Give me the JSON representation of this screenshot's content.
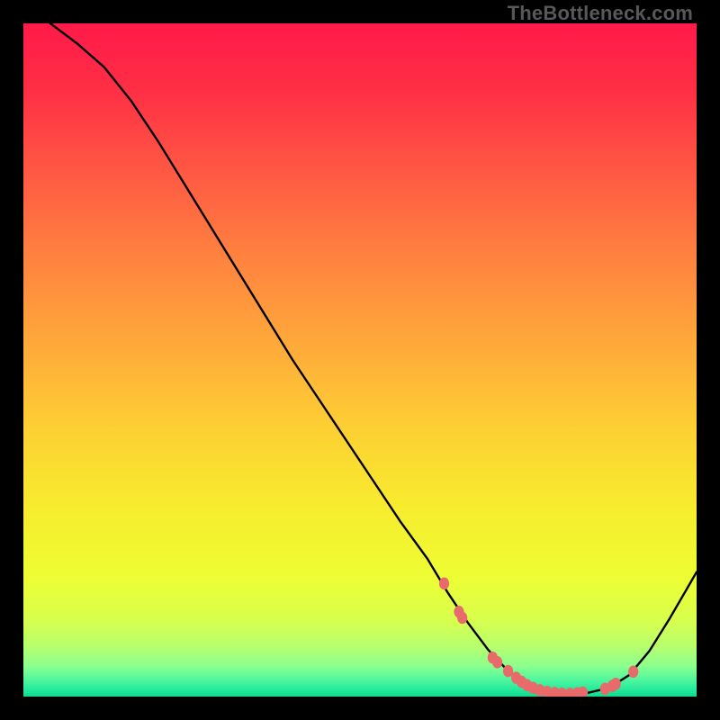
{
  "watermark": {
    "text": "TheBottleneck.com"
  },
  "chart_data": {
    "type": "line",
    "title": "",
    "xlabel": "",
    "ylabel": "",
    "xlim": [
      0,
      100
    ],
    "ylim": [
      0,
      100
    ],
    "grid": false,
    "legend": false,
    "series": [
      {
        "name": "curve",
        "x": [
          4,
          8,
          12,
          16,
          20,
          24,
          28,
          32,
          36,
          40,
          44,
          48,
          52,
          56,
          60,
          63,
          66,
          69,
          72,
          75,
          78,
          81,
          84,
          87,
          90,
          93,
          96,
          100
        ],
        "y": [
          100,
          97,
          93.5,
          88.5,
          82.5,
          76,
          69.5,
          63,
          56.5,
          50,
          44,
          38,
          32,
          26,
          20.5,
          15.5,
          11,
          7,
          3.8,
          1.6,
          0.6,
          0.4,
          0.6,
          1.3,
          3.2,
          6.8,
          11.6,
          18.5
        ]
      }
    ],
    "markers": [
      {
        "x": 62.5,
        "y": 16.8
      },
      {
        "x": 64.7,
        "y": 12.6
      },
      {
        "x": 65.2,
        "y": 11.7
      },
      {
        "x": 69.7,
        "y": 5.8
      },
      {
        "x": 70.4,
        "y": 5.1
      },
      {
        "x": 72.0,
        "y": 3.8
      },
      {
        "x": 73.2,
        "y": 2.8
      },
      {
        "x": 74.0,
        "y": 2.2
      },
      {
        "x": 74.8,
        "y": 1.7
      },
      {
        "x": 75.7,
        "y": 1.3
      },
      {
        "x": 76.7,
        "y": 0.95
      },
      {
        "x": 77.8,
        "y": 0.7
      },
      {
        "x": 78.9,
        "y": 0.55
      },
      {
        "x": 80.0,
        "y": 0.45
      },
      {
        "x": 81.2,
        "y": 0.42
      },
      {
        "x": 82.3,
        "y": 0.5
      },
      {
        "x": 83.1,
        "y": 0.6
      },
      {
        "x": 86.4,
        "y": 1.15
      },
      {
        "x": 87.5,
        "y": 1.6
      },
      {
        "x": 88.0,
        "y": 1.9
      },
      {
        "x": 90.6,
        "y": 3.7
      }
    ],
    "gradient_stops": [
      {
        "offset": 0.0,
        "color": "#ff1a49"
      },
      {
        "offset": 0.1,
        "color": "#ff2f45"
      },
      {
        "offset": 0.22,
        "color": "#ff5843"
      },
      {
        "offset": 0.35,
        "color": "#ff833f"
      },
      {
        "offset": 0.48,
        "color": "#ffaa3a"
      },
      {
        "offset": 0.6,
        "color": "#fdcf33"
      },
      {
        "offset": 0.72,
        "color": "#f7ec2e"
      },
      {
        "offset": 0.82,
        "color": "#eefd33"
      },
      {
        "offset": 0.885,
        "color": "#d9ff4c"
      },
      {
        "offset": 0.925,
        "color": "#b8ff6d"
      },
      {
        "offset": 0.955,
        "color": "#8aff8e"
      },
      {
        "offset": 0.975,
        "color": "#50f79e"
      },
      {
        "offset": 0.992,
        "color": "#1ee79a"
      },
      {
        "offset": 1.0,
        "color": "#0fd989"
      }
    ],
    "marker_color": "#e86a6a",
    "line_color": "#000000"
  }
}
